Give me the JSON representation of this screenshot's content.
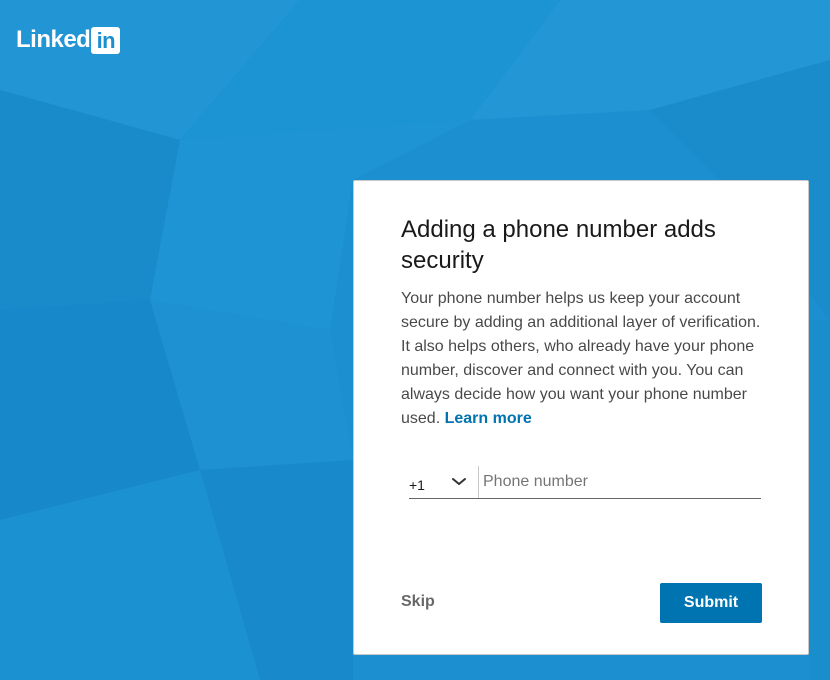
{
  "brand": {
    "logo_word": "Linked",
    "logo_box": "in"
  },
  "dialog": {
    "title": "Adding a phone number adds security",
    "body": "Your phone number helps us keep your account secure by adding an additional layer of verification. It also helps others, who already have your phone number, discover and connect with you. You can always decide how you want your phone number used.",
    "learn_more": "Learn more",
    "country_code": "+1",
    "country_chevron_icon": "chevron-down-icon",
    "phone_value": "",
    "phone_placeholder": "Phone number",
    "skip_label": "Skip",
    "submit_label": "Submit"
  },
  "colors": {
    "background": "#1b8fd0",
    "accent": "#0073b1",
    "card": "#ffffff"
  }
}
